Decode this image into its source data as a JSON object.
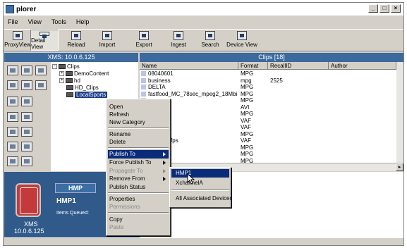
{
  "window": {
    "title": "plorer"
  },
  "menu": [
    "File",
    "View",
    "Tools",
    "Help"
  ],
  "toolbar": [
    "ProxyView",
    "Detail View",
    "Reload",
    "Import",
    "Export",
    "Ingest",
    "Search",
    "Device View"
  ],
  "left_header": "XMS: 10.0.6.125",
  "right_header": "Clips [18]",
  "tree": {
    "root": "Clips",
    "children": [
      "DemoContent",
      "hd",
      "HD_Clips",
      "LocalSports"
    ]
  },
  "columns": [
    "Name",
    "Format",
    "RecallID",
    "Author"
  ],
  "rows": [
    {
      "name": "08040601",
      "format": "MPG",
      "recall": ""
    },
    {
      "name": "business",
      "format": "mpg",
      "recall": "2525"
    },
    {
      "name": "DELTA",
      "format": "MPG",
      "recall": ""
    },
    {
      "name": "fastfood_MC_78sec_mpeg2_18Mbi...",
      "format": "MPG",
      "recall": ""
    },
    {
      "name": "",
      "format": "MPG",
      "recall": ""
    },
    {
      "name": "",
      "format": "AVI",
      "recall": ""
    },
    {
      "name": "A02",
      "format": "MPG",
      "recall": ""
    },
    {
      "name": "",
      "format": "VAF",
      "recall": ""
    },
    {
      "name": "_150",
      "format": "VAF",
      "recall": ""
    },
    {
      "name": "",
      "format": "MPG",
      "recall": ""
    },
    {
      "name": "P_60_30fps",
      "format": "VAF",
      "recall": ""
    },
    {
      "name": "",
      "format": "MPG",
      "recall": ""
    },
    {
      "name": "",
      "format": "MPG",
      "recall": ""
    },
    {
      "name": "",
      "format": "MPG",
      "recall": ""
    }
  ],
  "context_menu": {
    "open": "Open",
    "refresh": "Refresh",
    "new_category": "New Category",
    "rename": "Rename",
    "delete": "Delete",
    "publish_to": "Publish To",
    "force_publish_to": "Force Publish To",
    "propagate_to": "Propagate To",
    "remove_from": "Remove From",
    "publish_status": "Publish Status",
    "properties": "Properties",
    "permissions": "Permissions",
    "copy": "Copy",
    "paste": "Paste"
  },
  "submenu": {
    "hmp1": "HMP1",
    "xchannel": "XchannelA",
    "all": "All Associated Devices"
  },
  "device": {
    "tag": "HMP",
    "name": "HMP1",
    "queued_label": "Items Queued:",
    "xms": "XMS",
    "ip": "10.0.6.125"
  },
  "colors": {
    "header_blue": "#3d6a9e",
    "panel_blue": "#2f5a8a",
    "highlight": "#0a2a7a"
  }
}
